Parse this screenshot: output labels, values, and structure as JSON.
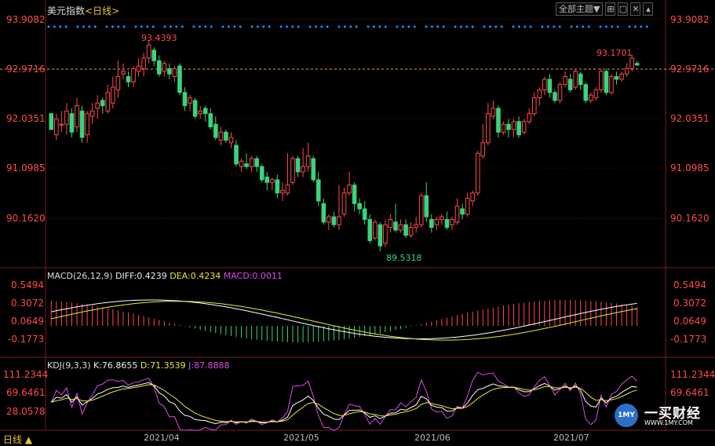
{
  "header": {
    "title": "美元指数",
    "period": "<日线>",
    "theme_button": "全部主题▼",
    "icons": [
      "grid-icon",
      "window-icon",
      "close-icon",
      "collapse-icon"
    ]
  },
  "price_panel": {
    "axis_labels": [
      "93.9082",
      "92.9716",
      "92.0351",
      "91.0985",
      "90.1620"
    ],
    "high_label": "93.4393",
    "low_label": "89.5318",
    "last_high_label": "93.1701",
    "current_price": "92.9716"
  },
  "macd_panel": {
    "label": "MACD(26,12,9)",
    "diff": "DIFF:0.4239",
    "dea": "DEA:0.4234",
    "macd": "MACD:0.0011",
    "axis_labels": [
      "0.5494",
      "0.3072",
      "0.0649",
      "-0.1773"
    ]
  },
  "kdj_panel": {
    "label": "KDJ(9,3,3)",
    "k": "K:76.8655",
    "d": "D:71.3539",
    "j": "J:87.8888",
    "axis_labels": [
      "111.2344",
      "69.6461",
      "28.0578"
    ]
  },
  "dates": [
    "2021/04",
    "2021/05",
    "2021/06",
    "2021/07"
  ],
  "bottom_tab": "日线 ▲",
  "watermark": {
    "brand": "一买财经",
    "url": "WWW.1MY.COM",
    "badge": "1MY"
  },
  "colors": {
    "up": "#ff4a4a",
    "down": "#3bd37c",
    "diff": "#ffffff",
    "dea": "#e8e83a",
    "j": "#d84ce8",
    "grid": "#7a1e1e",
    "dots": "#1f8fff"
  },
  "chart_data": {
    "type": "candlestick",
    "candles": [
      [
        92.05,
        91.75,
        92.05,
        91.75
      ],
      [
        91.65,
        91.95,
        92.05,
        91.55
      ],
      [
        91.85,
        91.85,
        92.1,
        91.7
      ],
      [
        91.85,
        92.1,
        92.25,
        91.65
      ],
      [
        92.05,
        91.7,
        92.15,
        91.6
      ],
      [
        91.8,
        92.2,
        92.35,
        91.7
      ],
      [
        92.1,
        91.6,
        92.2,
        91.5
      ],
      [
        91.65,
        92.05,
        92.1,
        91.5
      ],
      [
        92.0,
        92.1,
        92.25,
        91.85
      ],
      [
        92.15,
        92.25,
        92.4,
        91.95
      ],
      [
        92.3,
        92.2,
        92.35,
        92.05
      ],
      [
        92.1,
        92.45,
        92.6,
        92.05
      ],
      [
        92.25,
        92.55,
        92.75,
        92.15
      ],
      [
        92.5,
        92.75,
        93.05,
        92.35
      ],
      [
        92.8,
        92.85,
        93.0,
        92.7
      ],
      [
        92.75,
        92.65,
        92.85,
        92.55
      ],
      [
        92.65,
        92.9,
        92.95,
        92.55
      ],
      [
        92.85,
        92.95,
        93.1,
        92.75
      ],
      [
        92.9,
        93.1,
        93.2,
        92.75
      ],
      [
        93.1,
        93.35,
        93.44,
        93.0
      ],
      [
        93.25,
        93.05,
        93.3,
        92.95
      ],
      [
        93.05,
        92.8,
        93.15,
        92.75
      ],
      [
        92.85,
        93.0,
        93.05,
        92.75
      ],
      [
        92.9,
        92.8,
        93.0,
        92.7
      ],
      [
        92.75,
        92.9,
        92.95,
        92.65
      ],
      [
        92.95,
        92.45,
        93.0,
        92.4
      ],
      [
        92.45,
        92.2,
        92.55,
        92.1
      ],
      [
        92.25,
        92.35,
        92.4,
        92.1
      ],
      [
        92.3,
        92.0,
        92.35,
        91.95
      ],
      [
        92.05,
        92.1,
        92.2,
        91.95
      ],
      [
        92.15,
        92.05,
        92.2,
        91.9
      ],
      [
        92.05,
        91.8,
        92.15,
        91.75
      ],
      [
        91.85,
        91.6,
        92.0,
        91.55
      ],
      [
        91.55,
        91.7,
        91.8,
        91.45
      ],
      [
        91.7,
        91.55,
        91.75,
        91.5
      ],
      [
        91.5,
        91.6,
        91.7,
        91.4
      ],
      [
        91.45,
        91.1,
        91.55,
        91.05
      ],
      [
        91.05,
        91.15,
        91.2,
        90.95
      ],
      [
        91.1,
        91.05,
        91.3,
        91.0
      ],
      [
        91.05,
        91.2,
        91.25,
        90.95
      ],
      [
        91.2,
        91.05,
        91.25,
        90.95
      ],
      [
        91.05,
        90.8,
        91.1,
        90.75
      ],
      [
        90.85,
        90.75,
        90.95,
        90.6
      ],
      [
        90.75,
        90.8,
        90.85,
        90.6
      ],
      [
        90.8,
        90.55,
        90.9,
        90.45
      ],
      [
        90.55,
        90.6,
        90.75,
        90.4
      ],
      [
        90.55,
        90.7,
        91.3,
        90.5
      ],
      [
        90.75,
        91.2,
        91.25,
        90.7
      ],
      [
        91.2,
        90.95,
        91.25,
        90.85
      ],
      [
        90.95,
        91.05,
        91.4,
        90.85
      ],
      [
        91.05,
        91.25,
        91.5,
        90.95
      ],
      [
        91.2,
        90.8,
        91.25,
        90.75
      ],
      [
        90.8,
        90.4,
        90.95,
        90.3
      ],
      [
        90.35,
        90.0,
        90.45,
        89.95
      ],
      [
        90.0,
        90.1,
        90.15,
        89.85
      ],
      [
        90.1,
        89.95,
        90.2,
        89.9
      ],
      [
        89.95,
        90.1,
        90.7,
        89.85
      ],
      [
        90.15,
        90.55,
        90.65,
        90.1
      ],
      [
        90.55,
        90.7,
        90.95,
        90.5
      ],
      [
        90.7,
        90.35,
        90.75,
        90.2
      ],
      [
        90.35,
        90.25,
        90.45,
        90.15
      ],
      [
        90.25,
        90.05,
        90.4,
        89.95
      ],
      [
        90.05,
        89.65,
        90.15,
        89.6
      ],
      [
        89.7,
        90.0,
        90.05,
        89.65
      ],
      [
        89.95,
        89.55,
        90.0,
        89.45
      ],
      [
        89.6,
        89.95,
        90.05,
        89.53
      ],
      [
        89.9,
        90.05,
        90.15,
        89.8
      ],
      [
        90.0,
        89.85,
        90.35,
        89.8
      ],
      [
        89.85,
        89.95,
        90.05,
        89.8
      ],
      [
        89.95,
        89.75,
        90.05,
        89.7
      ],
      [
        89.75,
        89.9,
        90.0,
        89.7
      ],
      [
        89.9,
        89.95,
        90.1,
        89.8
      ],
      [
        89.95,
        90.5,
        90.55,
        89.9
      ],
      [
        90.5,
        90.1,
        90.75,
        90.0
      ],
      [
        90.05,
        89.9,
        90.15,
        89.8
      ],
      [
        89.95,
        90.05,
        90.1,
        89.85
      ],
      [
        90.05,
        90.1,
        90.15,
        89.95
      ],
      [
        90.05,
        89.9,
        90.2,
        89.85
      ],
      [
        89.95,
        90.05,
        90.1,
        89.85
      ],
      [
        90.0,
        90.3,
        90.45,
        89.95
      ],
      [
        90.25,
        90.15,
        90.35,
        90.05
      ],
      [
        90.15,
        90.45,
        90.55,
        90.1
      ],
      [
        90.4,
        90.55,
        90.6,
        90.3
      ],
      [
        90.55,
        91.3,
        91.35,
        90.5
      ],
      [
        91.25,
        91.5,
        91.85,
        91.2
      ],
      [
        91.5,
        92.05,
        92.25,
        91.45
      ],
      [
        92.0,
        92.15,
        92.3,
        91.95
      ],
      [
        92.15,
        91.7,
        92.2,
        91.6
      ],
      [
        91.7,
        91.85,
        91.9,
        91.65
      ],
      [
        91.85,
        91.75,
        91.95,
        91.6
      ],
      [
        91.75,
        91.9,
        91.95,
        91.6
      ],
      [
        91.9,
        91.65,
        92.0,
        91.6
      ],
      [
        91.7,
        91.9,
        91.95,
        91.65
      ],
      [
        91.9,
        92.05,
        92.15,
        91.85
      ],
      [
        92.05,
        92.35,
        92.45,
        92.0
      ],
      [
        92.35,
        92.5,
        92.55,
        92.2
      ],
      [
        92.5,
        92.7,
        92.75,
        92.4
      ],
      [
        92.7,
        92.45,
        92.8,
        92.35
      ],
      [
        92.45,
        92.3,
        92.5,
        92.25
      ],
      [
        92.3,
        92.6,
        92.65,
        92.25
      ],
      [
        92.6,
        92.75,
        92.85,
        92.55
      ],
      [
        92.7,
        92.5,
        92.8,
        92.45
      ],
      [
        92.55,
        92.85,
        92.9,
        92.5
      ],
      [
        92.8,
        92.6,
        92.85,
        92.5
      ],
      [
        92.6,
        92.3,
        92.65,
        92.25
      ],
      [
        92.3,
        92.4,
        92.45,
        92.25
      ],
      [
        92.35,
        92.5,
        92.55,
        92.3
      ],
      [
        92.5,
        92.85,
        92.9,
        92.45
      ],
      [
        92.85,
        92.45,
        92.9,
        92.4
      ],
      [
        92.45,
        92.75,
        92.8,
        92.4
      ],
      [
        92.75,
        92.7,
        92.85,
        92.6
      ],
      [
        92.7,
        92.8,
        92.85,
        92.65
      ],
      [
        92.8,
        92.9,
        93.0,
        92.75
      ],
      [
        92.9,
        93.1,
        93.17,
        92.85
      ],
      [
        93.0,
        92.97,
        93.05,
        92.95
      ]
    ],
    "ylim": [
      89.3,
      94.05
    ],
    "dates": [
      "2021/04",
      "2021/05",
      "2021/06",
      "2021/07"
    ]
  }
}
